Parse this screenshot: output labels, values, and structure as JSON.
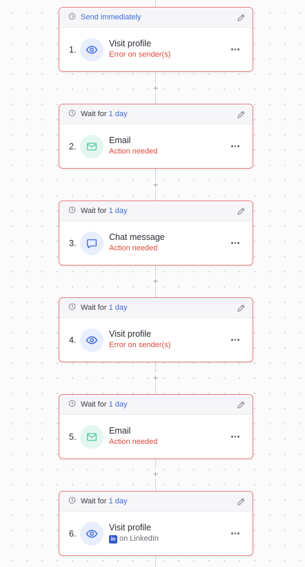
{
  "steps": [
    {
      "number": "1.",
      "header_prefix": "Send immediately",
      "header_value": "",
      "header_style": "accent",
      "title": "Visit profile",
      "status": "Error on sender(s)",
      "status_type": "error",
      "icon": "eye-icon",
      "icon_color": "blue"
    },
    {
      "number": "2.",
      "header_prefix": "Wait for",
      "header_value": "1 day",
      "title": "Email",
      "status": "Action needed",
      "status_type": "error",
      "icon": "mail-icon",
      "icon_color": "green"
    },
    {
      "number": "3.",
      "header_prefix": "Wait for",
      "header_value": "1 day",
      "title": "Chat message",
      "status": "Action needed",
      "status_type": "error",
      "icon": "chat-icon",
      "icon_color": "blue"
    },
    {
      "number": "4.",
      "header_prefix": "Wait for",
      "header_value": "1 day",
      "title": "Visit profile",
      "status": "Error on sender(s)",
      "status_type": "error",
      "icon": "eye-icon",
      "icon_color": "blue"
    },
    {
      "number": "5.",
      "header_prefix": "Wait for",
      "header_value": "1 day",
      "title": "Email",
      "status": "Action needed",
      "status_type": "error",
      "icon": "mail-icon",
      "icon_color": "green"
    },
    {
      "number": "6.",
      "header_prefix": "Wait for",
      "header_value": "1 day",
      "title": "Visit profile",
      "status": "on LinkedIn",
      "status_type": "linkedin",
      "icon": "eye-icon",
      "icon_color": "blue"
    }
  ],
  "add_button_label": "+",
  "linkedin_badge": "in",
  "colors": {
    "accent": "#3d6bdc",
    "error": "#e04a3c",
    "card_border": "#ea7c7c",
    "mail_green": "#4fc7a0"
  }
}
